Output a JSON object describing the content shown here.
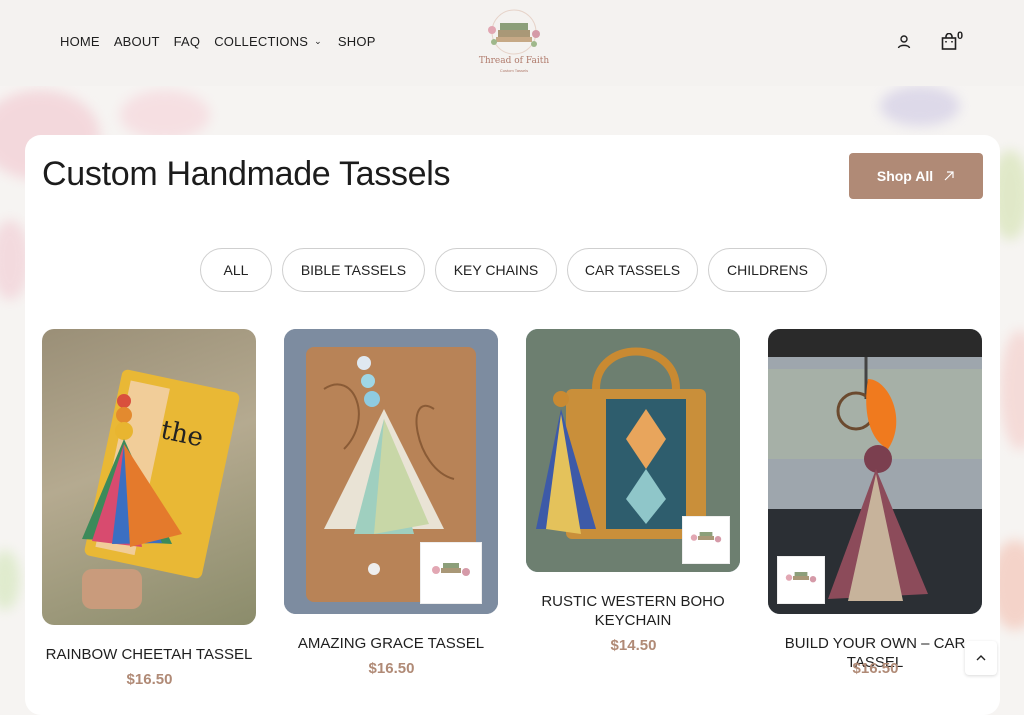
{
  "nav": {
    "items": [
      {
        "label": "HOME"
      },
      {
        "label": "ABOUT"
      },
      {
        "label": "FAQ"
      },
      {
        "label": "COLLECTIONS"
      },
      {
        "label": "SHOP"
      }
    ],
    "cart_count": "0"
  },
  "logo": {
    "text": "Thread of Faith",
    "sub": "Custom Tassels"
  },
  "section": {
    "title": "Custom Handmade Tassels",
    "shop_all_label": "Shop All"
  },
  "filters": [
    "ALL",
    "BIBLE TASSELS",
    "KEY CHAINS",
    "CAR TASSELS",
    "CHILDRENS"
  ],
  "products": [
    {
      "name": "RAINBOW CHEETAH TASSEL",
      "price": "$16.50"
    },
    {
      "name": "AMAZING GRACE TASSEL",
      "price": "$16.50"
    },
    {
      "name": "RUSTIC WESTERN BOHO KEYCHAIN",
      "price": "$14.50"
    },
    {
      "name": "BUILD YOUR OWN – CAR TASSEL",
      "price": "$16.50"
    }
  ],
  "colors": {
    "accent": "#b08a76",
    "background": "#f6f4f2"
  },
  "icons": [
    "user-icon",
    "cart-icon",
    "arrow-up-right-icon",
    "chevron-up-icon",
    "chevron-down-icon"
  ]
}
